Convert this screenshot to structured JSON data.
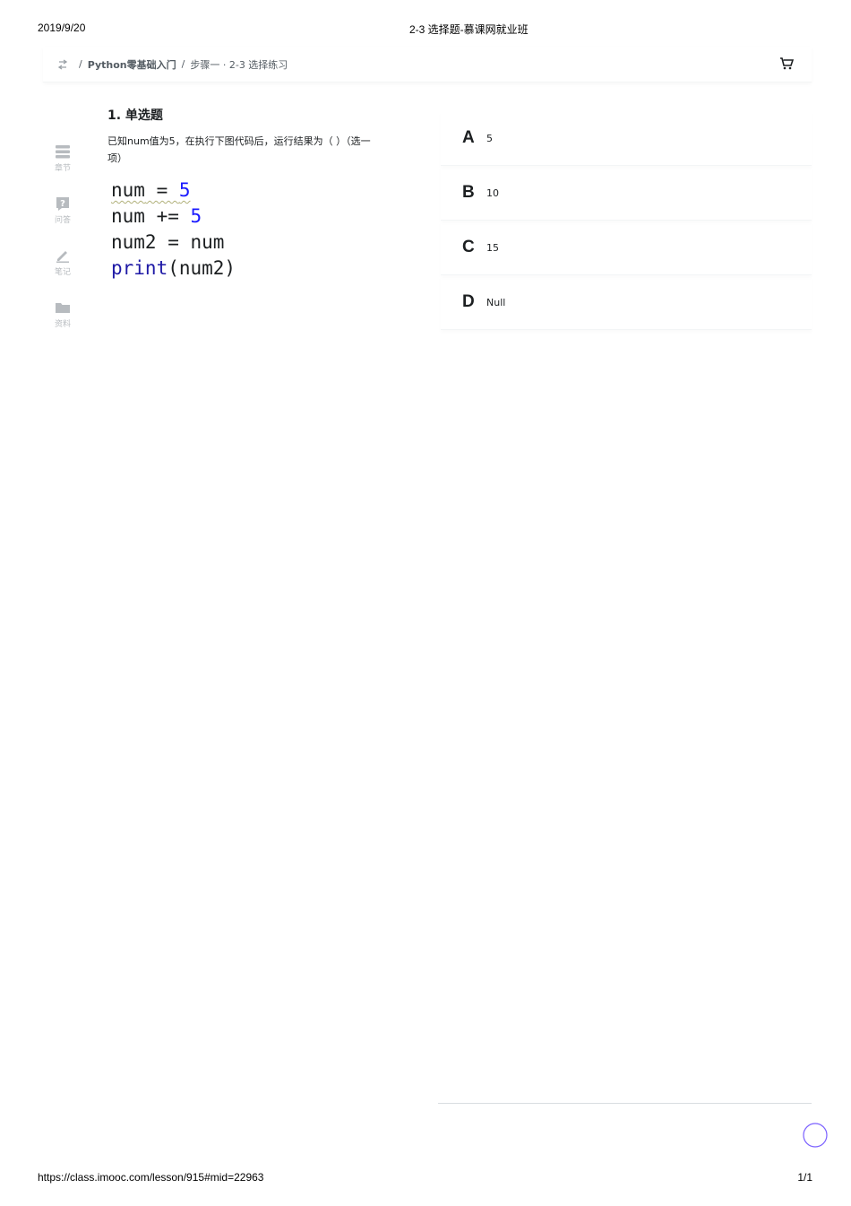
{
  "print": {
    "date": "2019/9/20",
    "title": "2-3 选择题-慕课网就业班",
    "url": "https://class.imooc.com/lesson/915#mid=22963",
    "page": "1/1"
  },
  "breadcrumb": {
    "separator": "/",
    "course": "Python零基础入门",
    "lesson": "步骤一 · 2-3 选择练习"
  },
  "sidebar": {
    "items": [
      {
        "icon": "chapters-icon",
        "label": "章节"
      },
      {
        "icon": "question-icon",
        "label": "问答"
      },
      {
        "icon": "pencil-icon",
        "label": "笔记"
      },
      {
        "icon": "folder-icon",
        "label": "资料"
      }
    ]
  },
  "question": {
    "title": "1. 单选题",
    "text": "已知num值为5，在执行下图代码后，运行结果为（ ）（选一项）",
    "code": {
      "line1_var": "num",
      "line1_op": " = ",
      "line1_val": "5",
      "line2_var": "num",
      "line2_op": " += ",
      "line2_val": "5",
      "line3": "num2 = num",
      "line4_fn": "print",
      "line4_args": "(num2)"
    }
  },
  "options": [
    {
      "letter": "A",
      "text": "5"
    },
    {
      "letter": "B",
      "text": "10"
    },
    {
      "letter": "C",
      "text": "15"
    },
    {
      "letter": "D",
      "text": "Null"
    }
  ],
  "colors": {
    "accent": "#7b61ff",
    "text": "#1c1f21",
    "muted": "#b7bbbf",
    "code_number": "#1a1aff",
    "code_function": "#1f1aa6"
  }
}
